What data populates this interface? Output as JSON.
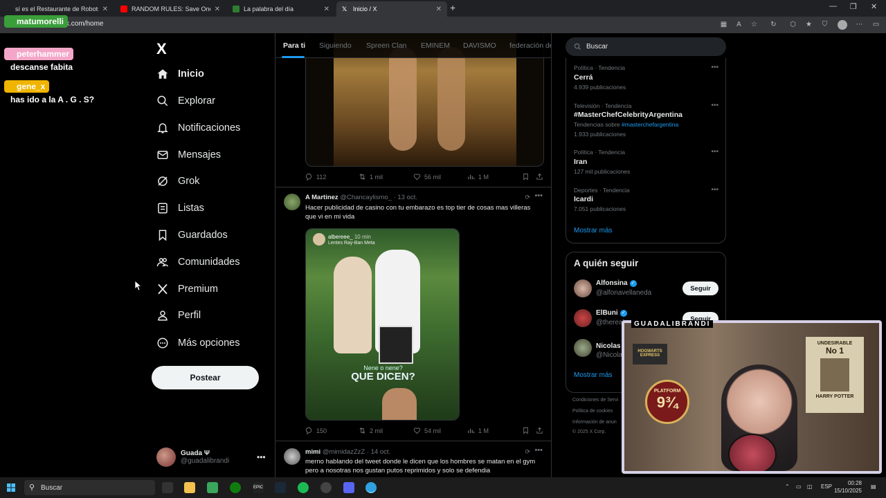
{
  "browser": {
    "tabs": [
      {
        "title": "sí es el Restaurante de Robots e",
        "active": false
      },
      {
        "title": "RANDOM RULES: Save One Song",
        "active": false
      },
      {
        "title": "La palabra del día",
        "active": false
      },
      {
        "title": "Inicio / X",
        "active": true
      }
    ],
    "url": "x.com/home"
  },
  "stream_chat": [
    {
      "user": "matumorelli",
      "badge": "1",
      "message": ""
    },
    {
      "user": "peterhammer",
      "badge": "",
      "message": "descanse fabita"
    },
    {
      "user": "gene_x",
      "badge": "1",
      "message": "has ido a la A . G . S?"
    }
  ],
  "nav": {
    "logo": "X",
    "items": [
      {
        "label": "Inicio",
        "icon": "home-icon"
      },
      {
        "label": "Explorar",
        "icon": "search-icon"
      },
      {
        "label": "Notificaciones",
        "icon": "bell-icon"
      },
      {
        "label": "Mensajes",
        "icon": "mail-icon"
      },
      {
        "label": "Grok",
        "icon": "grok-icon"
      },
      {
        "label": "Listas",
        "icon": "list-icon"
      },
      {
        "label": "Guardados",
        "icon": "bookmark-icon"
      },
      {
        "label": "Comunidades",
        "icon": "communities-icon"
      },
      {
        "label": "Premium",
        "icon": "x-icon"
      },
      {
        "label": "Perfil",
        "icon": "person-icon"
      },
      {
        "label": "Más opciones",
        "icon": "more-circle-icon"
      }
    ],
    "post_button": "Postear",
    "profile": {
      "name": "Guada Ψ",
      "handle": "@guadalibrandi"
    }
  },
  "feed": {
    "tabs": [
      "Para ti",
      "Siguiendo",
      "Spreen Clan",
      "EMINEM",
      "DAVISMO",
      "federación de"
    ],
    "post1_actions": {
      "replies": "112",
      "reposts": "1 mil",
      "likes": "56 mil",
      "views": "1 M"
    },
    "post2": {
      "name": "A Martinez",
      "handle": "@Chancaylismo_",
      "date": "· 13 oct.",
      "text": "Hacer publicidad de casino con tu embarazo es top tier de cosas mas villeras que vi en mi vida",
      "media": {
        "user": "albereee_",
        "time": "10 min",
        "sub": "Lentes Ray-Ban Meta",
        "caption1": "Nene o nene?",
        "caption2": "QUE DICEN?"
      },
      "actions": {
        "replies": "150",
        "reposts": "2 mil",
        "likes": "54 mil",
        "views": "1 M"
      }
    },
    "post3": {
      "name": "mimi",
      "handle": "@mimidazZzZ",
      "date": "· 14 oct.",
      "text": "merno hablando del tweet donde le dicen que los hombres se matan en el gym pero a nosotras nos gustan putos reprimidos y solo se defendia"
    }
  },
  "sidebar": {
    "search_placeholder": "Buscar",
    "trends": [
      {
        "meta": "Política · Tendencia",
        "title": "Cerrá",
        "count": "4.939 publicaciones",
        "extra_prefix": "",
        "extra_link": ""
      },
      {
        "meta": "Televisión · Tendencia",
        "title": "#MasterChefCelebrityArgentina",
        "count": "1.933 publicaciones",
        "extra_prefix": "Tendencias sobre",
        "extra_link": "#masterchefargentina"
      },
      {
        "meta": "Política · Tendencia",
        "title": "Iran",
        "count": "127 mil publicaciones",
        "extra_prefix": "",
        "extra_link": ""
      },
      {
        "meta": "Deportes · Tendencia",
        "title": "Icardi",
        "count": "7.051 publicaciones",
        "extra_prefix": "",
        "extra_link": ""
      }
    ],
    "show_more": "Mostrar más",
    "who_to_follow": {
      "title": "A quién seguir",
      "accounts": [
        {
          "name": "Alfonsina",
          "handle": "@alfonavellaneda",
          "button": "Seguir"
        },
        {
          "name": "ElBuni",
          "handle": "@thereal",
          "button": "Seguir"
        },
        {
          "name": "Nicolas D",
          "handle": "@Nicola",
          "button": ""
        }
      ],
      "show_more": "Mostrar más"
    },
    "footer": [
      "Condiciones de Servi",
      "Política de cookies",
      "Información de anun",
      "© 2025 X Corp."
    ]
  },
  "webcam": {
    "title": "GUADALIBRANDI",
    "sign1": "UNDESIRABLE",
    "sign2": "No 1",
    "sign3": "HARRY POTTER",
    "sign4": "HOGWARTS EXPRESS",
    "sign5": "PLATFORM"
  },
  "taskbar": {
    "search": "Buscar",
    "lang": "ESP",
    "time": "00:28",
    "date": "15/10/2025"
  }
}
